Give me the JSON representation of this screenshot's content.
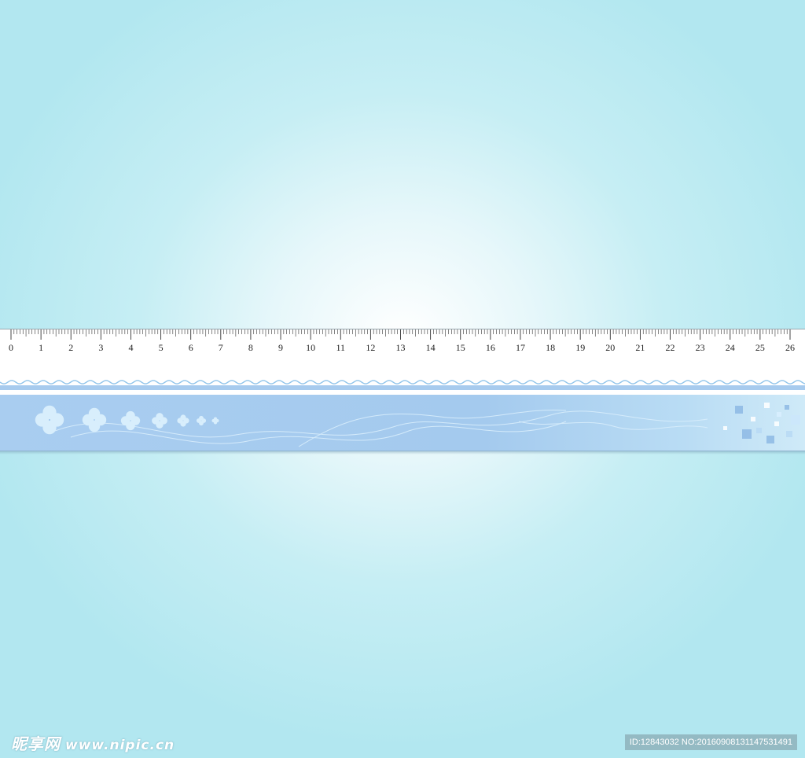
{
  "ruler": {
    "unit_labels": [
      "0",
      "1",
      "2",
      "3",
      "4",
      "5",
      "6",
      "7",
      "8",
      "9",
      "10",
      "11",
      "12",
      "13",
      "14",
      "15",
      "16",
      "17",
      "18",
      "19",
      "20",
      "21",
      "22",
      "23",
      "24",
      "25",
      "26"
    ],
    "subdivisions_per_unit": 10,
    "colors": {
      "body": "#ffffff",
      "band": "#a8ccee",
      "wave": "#8fc4ea",
      "decor": "#d6ecfb"
    }
  },
  "watermark": {
    "site_name": "昵享网",
    "site_url": "www.nipic.cn",
    "image_id": "ID:12843032 NO:20160908131147531491"
  }
}
